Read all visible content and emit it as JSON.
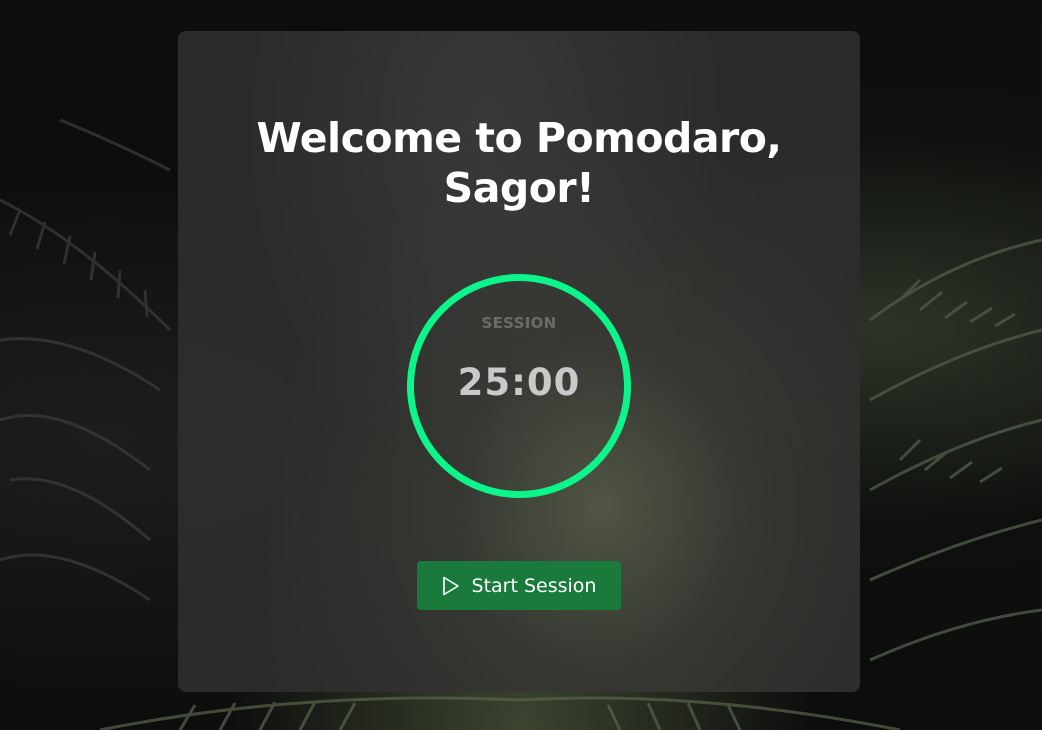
{
  "welcome": {
    "title": "Welcome to Pomodaro, Sagor!"
  },
  "timer": {
    "label": "SESSION",
    "time": "25:00",
    "ring_color": "#0cf58a"
  },
  "controls": {
    "start_label": "Start Session",
    "start_icon": "play-icon",
    "button_color": "#1a7a3c"
  },
  "background": {
    "image": "fern-leaves-icon"
  }
}
